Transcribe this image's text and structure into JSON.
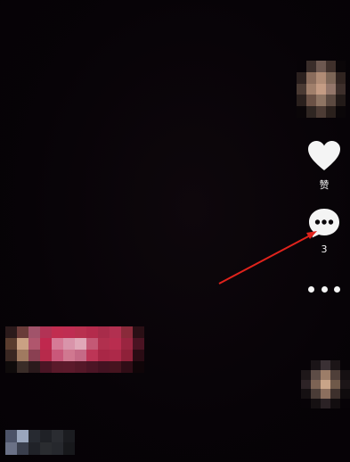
{
  "sidebar": {
    "like_label": "赞",
    "comment_count": "3"
  },
  "icons": {
    "avatar": "avatar-icon",
    "like": "heart-icon",
    "comment": "comment-bubble-icon",
    "more": "more-dots-icon"
  },
  "colors": {
    "background": "#070307",
    "icon": "#f4f4f4",
    "annotation_arrow": "#e0231c",
    "pink_tag": "#c2264a"
  }
}
